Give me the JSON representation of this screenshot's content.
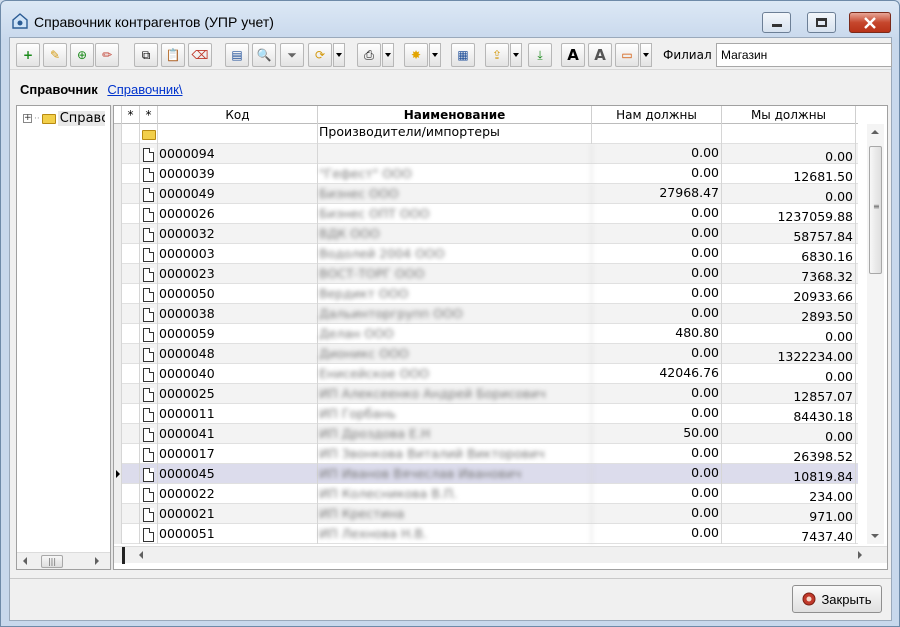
{
  "window": {
    "title": "Справочник контрагентов (УПР учет)"
  },
  "toolbar": {
    "filial_label": "Филиал",
    "filial_value": "Магазин",
    "buttons": [
      "add-icon",
      "edit-icon",
      "add-group-icon",
      "pencil-icon",
      "copy-icon",
      "paste-icon",
      "delete-icon",
      "table-icon",
      "find-icon",
      "filter-icon",
      "refresh-icon",
      "print-icon",
      "star-icon",
      "report-icon",
      "export-icon",
      "import-icon",
      "font-bold-icon",
      "font-outline-icon",
      "layout-icon"
    ]
  },
  "breadcrumb": {
    "label": "Справочник",
    "link": "Справочник\\"
  },
  "tree": {
    "root_label": "Справочник"
  },
  "grid": {
    "columns": {
      "star1": "*",
      "star2": "*",
      "code": "Код",
      "name": "Наименование",
      "owed_to_us": "Нам должны",
      "we_owe": "Мы должны"
    },
    "group_row": {
      "name": "Производители/импортеры"
    },
    "rows": [
      {
        "code": "0000094",
        "name": "",
        "owed_to_us": "0.00",
        "we_owe": "0.00"
      },
      {
        "code": "0000039",
        "name": "\"Гефест\" ООО",
        "owed_to_us": "0.00",
        "we_owe": "12681.50"
      },
      {
        "code": "0000049",
        "name": "Бизнес ООО",
        "owed_to_us": "27968.47",
        "we_owe": "0.00"
      },
      {
        "code": "0000026",
        "name": "Бизнес ОПТ ООО",
        "owed_to_us": "0.00",
        "we_owe": "1237059.88"
      },
      {
        "code": "0000032",
        "name": "ВДК ООО",
        "owed_to_us": "0.00",
        "we_owe": "58757.84"
      },
      {
        "code": "0000003",
        "name": "Водолей 2004 ООО",
        "owed_to_us": "0.00",
        "we_owe": "6830.16"
      },
      {
        "code": "0000023",
        "name": "ВОСТ-ТОРГ ООО",
        "owed_to_us": "0.00",
        "we_owe": "7368.32"
      },
      {
        "code": "0000050",
        "name": "Вердикт ООО",
        "owed_to_us": "0.00",
        "we_owe": "20933.66"
      },
      {
        "code": "0000038",
        "name": "Дальинторгрупп ООО",
        "owed_to_us": "0.00",
        "we_owe": "2893.50"
      },
      {
        "code": "0000059",
        "name": "Делан ООО",
        "owed_to_us": "480.80",
        "we_owe": "0.00"
      },
      {
        "code": "0000048",
        "name": "Дионикс ООО",
        "owed_to_us": "0.00",
        "we_owe": "1322234.00"
      },
      {
        "code": "0000040",
        "name": "Енисейское ООО",
        "owed_to_us": "42046.76",
        "we_owe": "0.00"
      },
      {
        "code": "0000025",
        "name": "ИП Алексеенко Андрей Борисович",
        "owed_to_us": "0.00",
        "we_owe": "12857.07"
      },
      {
        "code": "0000011",
        "name": "ИП Горбань",
        "owed_to_us": "0.00",
        "we_owe": "84430.18"
      },
      {
        "code": "0000041",
        "name": "ИП Дроздова Е.Н",
        "owed_to_us": "50.00",
        "we_owe": "0.00"
      },
      {
        "code": "0000017",
        "name": "ИП Звонкова Виталий Викторович",
        "owed_to_us": "0.00",
        "we_owe": "26398.52"
      },
      {
        "code": "0000045",
        "name": "ИП Иванов Вячеслав Иванович",
        "owed_to_us": "0.00",
        "we_owe": "10819.84"
      },
      {
        "code": "0000022",
        "name": "ИП Колесникова В.П.",
        "owed_to_us": "0.00",
        "we_owe": "234.00"
      },
      {
        "code": "0000021",
        "name": "ИП Крестина",
        "owed_to_us": "0.00",
        "we_owe": "971.00"
      },
      {
        "code": "0000051",
        "name": "ИП Лехнова Н.В.",
        "owed_to_us": "0.00",
        "we_owe": "7437.40"
      }
    ],
    "selected_index": 16
  },
  "footer": {
    "close_label": "Закрыть"
  }
}
